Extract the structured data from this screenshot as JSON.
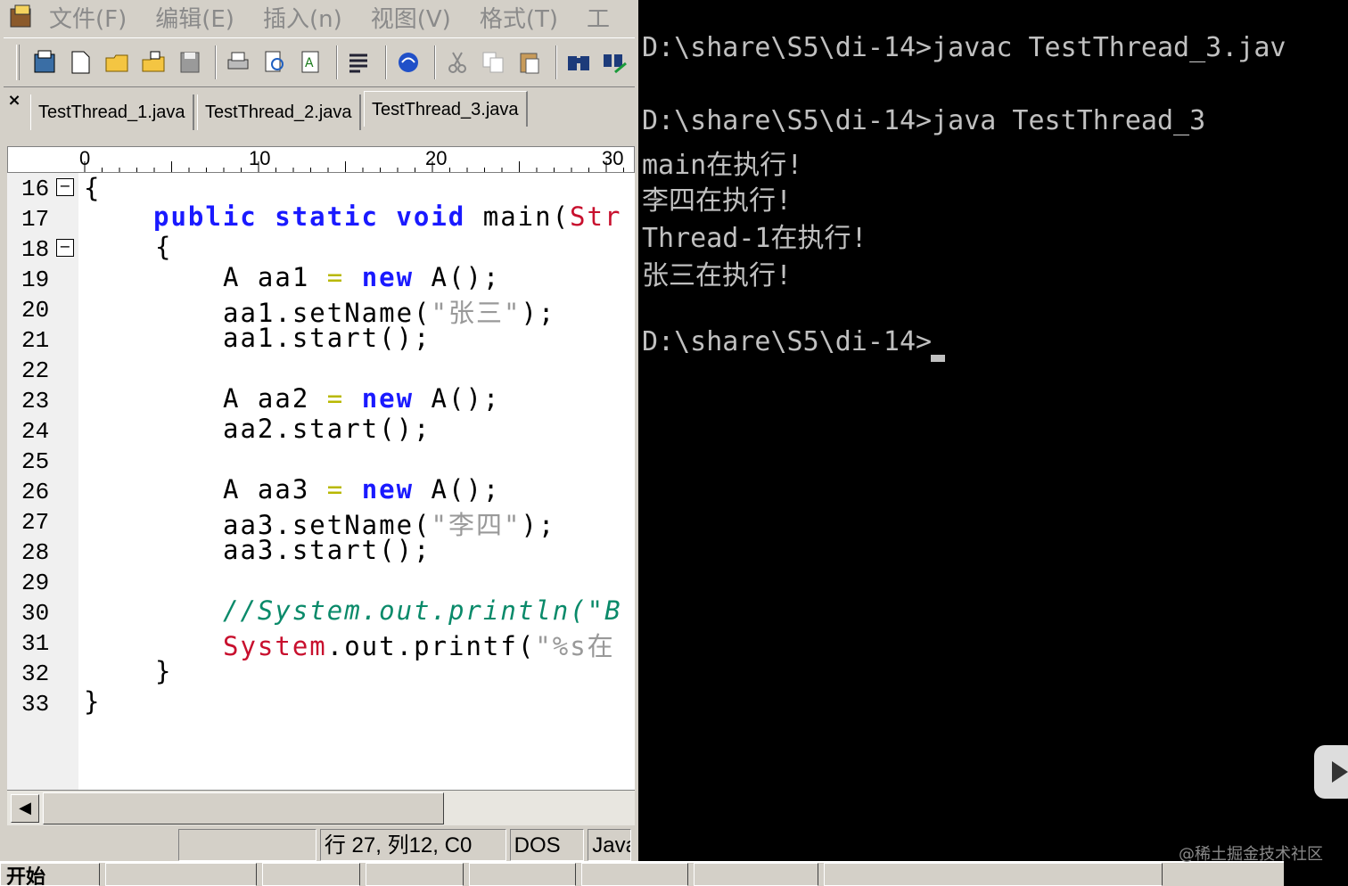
{
  "menu": [
    "文件(F)",
    "编辑(E)",
    "插入(n)",
    "视图(V)",
    "格式(T)",
    "工"
  ],
  "toolbar_icons": [
    "open-project-icon",
    "new-file-icon",
    "open-folder-icon",
    "open-file-icon",
    "save-icon",
    "print-icon",
    "print-preview-icon",
    "spellcheck-icon",
    "word-wrap-icon",
    "browser-icon",
    "cut-icon",
    "copy-icon",
    "paste-icon",
    "find-icon",
    "replace-icon"
  ],
  "tabs": [
    "TestThread_1.java",
    "TestThread_2.java",
    "TestThread_3.java"
  ],
  "active_tab": "TestThread_3.java",
  "ruler": [
    "0",
    "10",
    "20",
    "30"
  ],
  "line_numbers": [
    "16",
    "17",
    "18",
    "19",
    "20",
    "21",
    "22",
    "23",
    "24",
    "25",
    "26",
    "27",
    "28",
    "29",
    "30",
    "31",
    "32",
    "33"
  ],
  "code": {
    "l16": "{",
    "l17_kw": "public static void",
    "l17_rest": " main(",
    "l17_red": "Str",
    "l18": "{",
    "l19_a": "A aa1 ",
    "l19_op": "=",
    "l19_kw": " new",
    "l19_rest": " A();",
    "l20_a": "aa1.setName(",
    "l20_str": "\"张三\"",
    "l20_b": ");",
    "l21": "aa1.start();",
    "l23_a": "A aa2 ",
    "l23_op": "=",
    "l23_kw": " new",
    "l23_rest": " A();",
    "l24": "aa2.start();",
    "l26_a": "A aa3 ",
    "l26_op": "=",
    "l26_kw": " new",
    "l26_rest": " A();",
    "l27_a": "aa3.setName(",
    "l27_str": "\"李四\"",
    "l27_b": ");",
    "l28": "aa3.start();",
    "l30": "//System.out.println(\"B",
    "l31_red": "System",
    "l31_a": ".out.printf(",
    "l31_str": "\"%s在",
    "l32": "}",
    "l33": "}"
  },
  "status": {
    "position": "行 27, 列12, C0",
    "format": "DOS",
    "lang": "Java"
  },
  "console": [
    "D:\\share\\S5\\di-14>javac TestThread_3.jav",
    "",
    "D:\\share\\S5\\di-14>java TestThread_3",
    "main在执行!",
    "李四在执行!",
    "Thread-1在执行!",
    "张三在执行!",
    "",
    "D:\\share\\S5\\di-14>"
  ],
  "taskbar": {
    "start_label": "开始"
  },
  "watermark": "@稀土掘金技术社区"
}
